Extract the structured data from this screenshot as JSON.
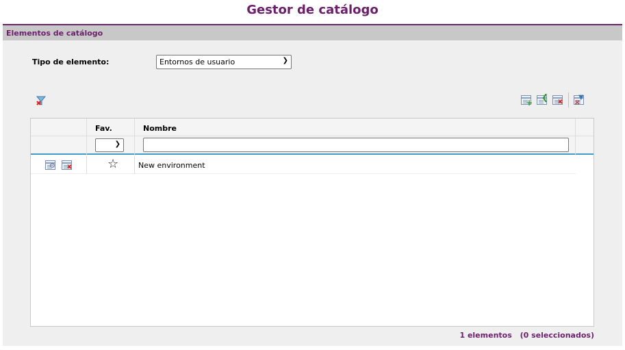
{
  "page": {
    "title": "Gestor de catálogo"
  },
  "section": {
    "title": "Elementos de catálogo"
  },
  "filter": {
    "type_label": "Tipo de elemento:",
    "type_value": "Entornos de usuario"
  },
  "toolbar": {
    "left_icons": [
      "clear-filter-icon"
    ],
    "right_icons": [
      "new-element-icon",
      "import-element-icon",
      "delete-selected-icon",
      "filter-options-icon"
    ]
  },
  "grid": {
    "columns": [
      "",
      "Fav.",
      "Nombre"
    ],
    "filters": {
      "fav_value": "",
      "name_placeholder": ""
    },
    "rows": [
      {
        "actions": [
          "properties-icon",
          "delete-icon"
        ],
        "favorite": false,
        "name": "New environment"
      }
    ]
  },
  "footer": {
    "count": "1 elementos",
    "selected": "(0 seleccionados)"
  },
  "colors": {
    "accent": "#6b1f6b",
    "header_bar": "#c8c8c8",
    "grid_border": "#3f9bc9"
  }
}
